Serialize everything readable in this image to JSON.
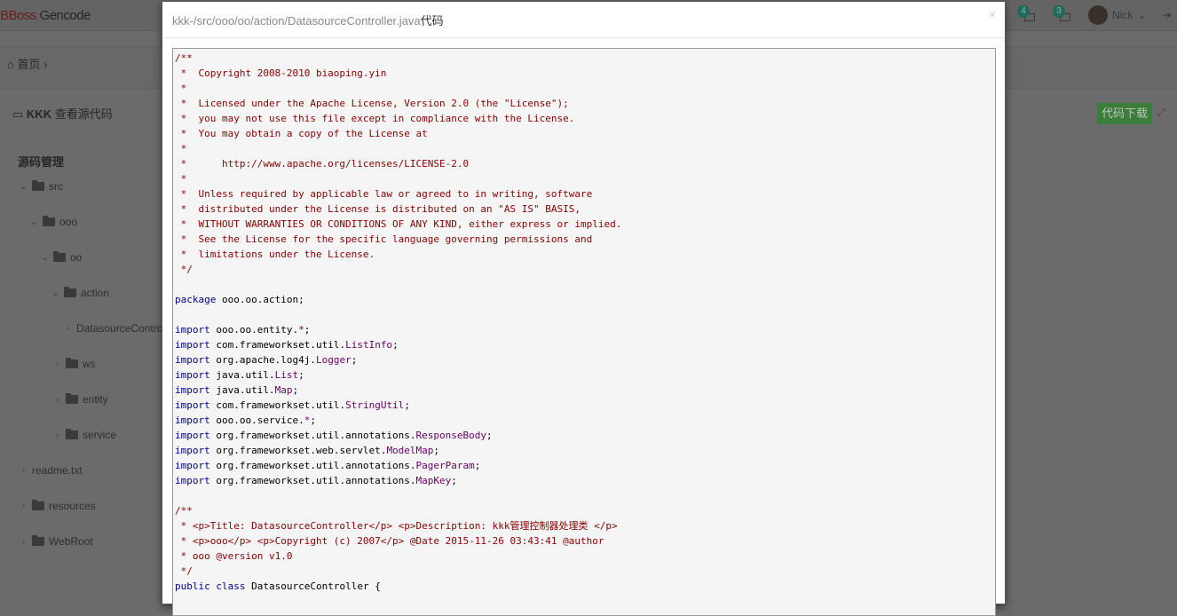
{
  "header": {
    "logo_red": "BBoss",
    "logo_gray": " Gencode",
    "messages_count": "4",
    "tasks_count": "3",
    "user_name": "Nick"
  },
  "breadcrumb": {
    "home": "首页",
    "separator": "›"
  },
  "panel": {
    "project": "KKK",
    "title": "查看源代码",
    "download_label": "代码下载"
  },
  "tree": {
    "title": "源码管理",
    "nodes": [
      {
        "label": "src",
        "type": "folder",
        "expanded": true
      },
      {
        "label": "ooo",
        "type": "folder",
        "expanded": true
      },
      {
        "label": "oo",
        "type": "folder",
        "expanded": true
      },
      {
        "label": "action",
        "type": "folder",
        "expanded": true
      },
      {
        "label": "DatasourceController.java",
        "type": "file",
        "expanded": false
      },
      {
        "label": "ws",
        "type": "folder",
        "expanded": false
      },
      {
        "label": "entity",
        "type": "folder",
        "expanded": false
      },
      {
        "label": "service",
        "type": "folder",
        "expanded": false
      },
      {
        "label": "readme.txt",
        "type": "file",
        "expanded": false
      },
      {
        "label": "resources",
        "type": "folder",
        "expanded": false
      },
      {
        "label": "WebRoot",
        "type": "folder",
        "expanded": false
      }
    ]
  },
  "modal": {
    "title_path": "kkk-/src/ooo/oo/action/DatasourceController.java",
    "title_suffix": "代码",
    "close": "×"
  },
  "code_colors": {
    "comment": "#880000",
    "keyword": "#000088",
    "type": "#660066",
    "plain": "#000000"
  },
  "code": [
    [
      [
        "c",
        "/**"
      ]
    ],
    [
      [
        "c",
        " *  Copyright 2008-2010 biaoping.yin"
      ]
    ],
    [
      [
        "c",
        " *"
      ]
    ],
    [
      [
        "c",
        " *  Licensed under the Apache License, Version 2.0 (the \"License\");"
      ]
    ],
    [
      [
        "c",
        " *  you may not use this file except in compliance with the License."
      ]
    ],
    [
      [
        "c",
        " *  You may obtain a copy of the License at"
      ]
    ],
    [
      [
        "c",
        " *"
      ]
    ],
    [
      [
        "c",
        " *      http://www.apache.org/licenses/LICENSE-2.0"
      ]
    ],
    [
      [
        "c",
        " *"
      ]
    ],
    [
      [
        "c",
        " *  Unless required by applicable law or agreed to in writing, software"
      ]
    ],
    [
      [
        "c",
        " *  distributed under the License is distributed on an \"AS IS\" BASIS,"
      ]
    ],
    [
      [
        "c",
        " *  WITHOUT WARRANTIES OR CONDITIONS OF ANY KIND, either express or implied."
      ]
    ],
    [
      [
        "c",
        " *  See the License for the specific language governing permissions and"
      ]
    ],
    [
      [
        "c",
        " *  limitations under the License."
      ]
    ],
    [
      [
        "c",
        " */"
      ]
    ],
    [],
    [
      [
        "k",
        "package"
      ],
      [
        "p",
        " ooo.oo.action;"
      ]
    ],
    [],
    [
      [
        "k",
        "import"
      ],
      [
        "p",
        " ooo.oo.entity."
      ],
      [
        "t",
        "*"
      ],
      [
        "p",
        ";"
      ]
    ],
    [
      [
        "k",
        "import"
      ],
      [
        "p",
        " com.frameworkset.util."
      ],
      [
        "t",
        "ListInfo"
      ],
      [
        "p",
        ";"
      ]
    ],
    [
      [
        "k",
        "import"
      ],
      [
        "p",
        " org.apache.log4j."
      ],
      [
        "t",
        "Logger"
      ],
      [
        "p",
        ";"
      ]
    ],
    [
      [
        "k",
        "import"
      ],
      [
        "p",
        " java.util."
      ],
      [
        "t",
        "List"
      ],
      [
        "p",
        ";"
      ]
    ],
    [
      [
        "k",
        "import"
      ],
      [
        "p",
        " java.util."
      ],
      [
        "t",
        "Map"
      ],
      [
        "p",
        ";"
      ]
    ],
    [
      [
        "k",
        "import"
      ],
      [
        "p",
        " com.frameworkset.util."
      ],
      [
        "t",
        "StringUtil"
      ],
      [
        "p",
        ";"
      ]
    ],
    [
      [
        "k",
        "import"
      ],
      [
        "p",
        " ooo.oo.service."
      ],
      [
        "t",
        "*"
      ],
      [
        "p",
        ";"
      ]
    ],
    [
      [
        "k",
        "import"
      ],
      [
        "p",
        " org.frameworkset.util.annotations."
      ],
      [
        "t",
        "ResponseBody"
      ],
      [
        "p",
        ";"
      ]
    ],
    [
      [
        "k",
        "import"
      ],
      [
        "p",
        " org.frameworkset.web.servlet."
      ],
      [
        "t",
        "ModelMap"
      ],
      [
        "p",
        ";"
      ]
    ],
    [
      [
        "k",
        "import"
      ],
      [
        "p",
        " org.frameworkset.util.annotations."
      ],
      [
        "t",
        "PagerParam"
      ],
      [
        "p",
        ";"
      ]
    ],
    [
      [
        "k",
        "import"
      ],
      [
        "p",
        " org.frameworkset.util.annotations."
      ],
      [
        "t",
        "MapKey"
      ],
      [
        "p",
        ";"
      ]
    ],
    [],
    [
      [
        "c",
        "/**"
      ]
    ],
    [
      [
        "c",
        " * <p>Title: DatasourceController</p> <p>Description: kkk管理控制器处理类 </p>"
      ]
    ],
    [
      [
        "c",
        " * <p>ooo</p> <p>Copyright (c) 2007</p> @Date 2015-11-26 03:43:41 @author"
      ]
    ],
    [
      [
        "c",
        " * ooo @version v1.0"
      ]
    ],
    [
      [
        "c",
        " */"
      ]
    ],
    [
      [
        "k",
        "public"
      ],
      [
        "p",
        " "
      ],
      [
        "k",
        "class"
      ],
      [
        "p",
        " DatasourceController {"
      ]
    ]
  ]
}
